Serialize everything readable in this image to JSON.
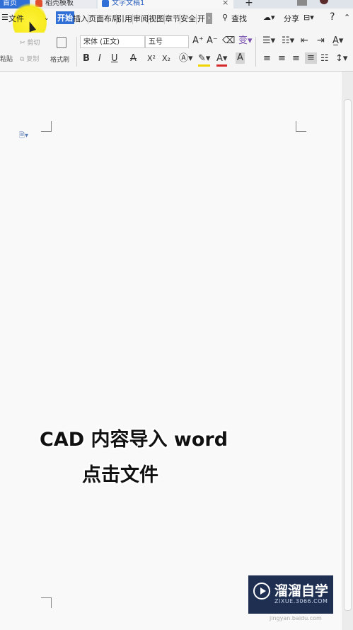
{
  "tabs": {
    "home": "首页",
    "templates": "稻壳模板",
    "document": "文字文稿1",
    "new_tab": "+"
  },
  "menu": {
    "file": "文件",
    "items": [
      "开始",
      "插入",
      "页面布局",
      "引用",
      "审阅",
      "视图",
      "章节",
      "安全",
      "开"
    ],
    "search": "查找",
    "share": "分享",
    "help": "?"
  },
  "toolbar": {
    "paste": "粘贴",
    "cut": "剪切",
    "copy": "复制",
    "format_painter": "格式刷",
    "font_name": "宋体 (正文)",
    "font_size": "五号",
    "bold": "B",
    "italic": "I",
    "underline": "U",
    "strikethrough": "A",
    "superscript": "X²",
    "subscript": "X₂",
    "font_grow": "A⁺",
    "font_shrink": "A⁻"
  },
  "caption": {
    "line1": "CAD 内容导入 word",
    "line2": "点击文件"
  },
  "logo": {
    "title": "溜溜自学",
    "subtitle": "ZIXUE.3066.COM"
  },
  "watermark": "jingyan.baidu.com",
  "colors": {
    "accent": "#2f6fd6",
    "highlight": "#f6ea1e",
    "logo_bg": "#1f2f52"
  }
}
